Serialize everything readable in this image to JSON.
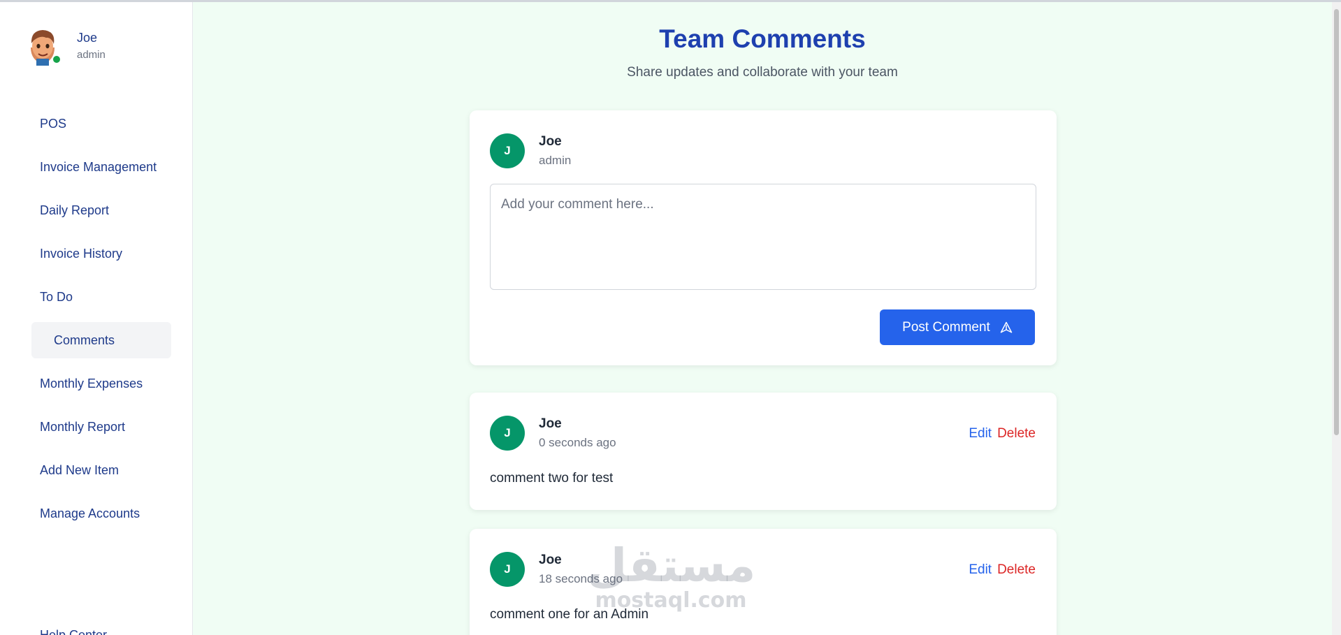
{
  "user": {
    "name": "Joe",
    "role": "admin",
    "initial": "J"
  },
  "sidebar": {
    "items": [
      {
        "label": "POS",
        "active": false
      },
      {
        "label": "Invoice Management",
        "active": false
      },
      {
        "label": "Daily Report",
        "active": false
      },
      {
        "label": "Invoice History",
        "active": false
      },
      {
        "label": "To Do",
        "active": false
      },
      {
        "label": "Comments",
        "active": true
      },
      {
        "label": "Monthly Expenses",
        "active": false
      },
      {
        "label": "Monthly Report",
        "active": false
      },
      {
        "label": "Add New Item",
        "active": false
      },
      {
        "label": "Manage Accounts",
        "active": false
      }
    ],
    "help_label": "Help Center"
  },
  "page": {
    "title": "Team Comments",
    "subtitle": "Share updates and collaborate with your team"
  },
  "composer": {
    "name": "Joe",
    "role": "admin",
    "initial": "J",
    "placeholder": "Add your comment here...",
    "post_label": "Post Comment"
  },
  "comments": [
    {
      "name": "Joe",
      "initial": "J",
      "time": "0 seconds ago",
      "text": "comment two for test",
      "edit_label": "Edit",
      "delete_label": "Delete"
    },
    {
      "name": "Joe",
      "initial": "J",
      "time": "18 seconds ago",
      "text": "comment one for an Admin",
      "edit_label": "Edit",
      "delete_label": "Delete"
    }
  ],
  "watermark": {
    "arabic": "مستقل",
    "latin": "mostaql.com"
  },
  "colors": {
    "accent": "#2563eb",
    "title": "#1e40af",
    "nav_text": "#1e3a8a",
    "avatar_bg": "#059669",
    "delete": "#dc2626",
    "background": "#f0fdf4",
    "online": "#16a34a"
  },
  "icons": {
    "profile_avatar": "cartoon-avatar-icon",
    "send": "send-icon"
  }
}
